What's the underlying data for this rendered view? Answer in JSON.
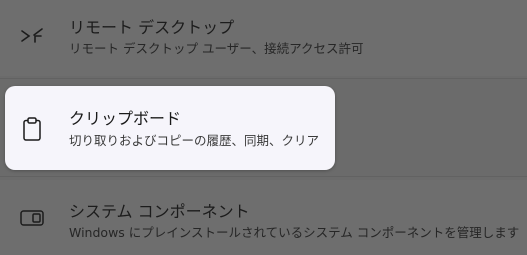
{
  "settings_list": {
    "items": [
      {
        "title": "リモート デスクトップ",
        "description": "リモート デスクトップ ユーザー、接続アクセス許可",
        "icon": "remote-desktop-icon"
      },
      {
        "title": "クリップボード",
        "description": "切り取りおよびコピーの履歴、同期、クリア",
        "icon": "clipboard-icon"
      },
      {
        "title": "システム コンポーネント",
        "description": "Windows にプレインストールされているシステム コンポーネントを管理します",
        "icon": "system-components-icon"
      }
    ]
  }
}
